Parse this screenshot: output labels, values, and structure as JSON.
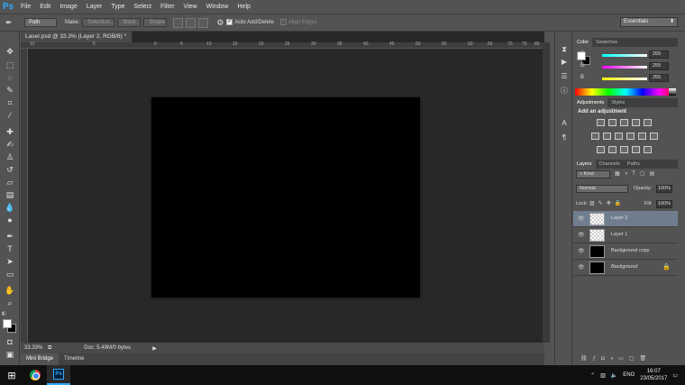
{
  "app": {
    "logo": "Ps"
  },
  "menubar": {
    "items": [
      "File",
      "Edit",
      "Image",
      "Layer",
      "Type",
      "Select",
      "Filter",
      "View",
      "Window",
      "Help"
    ]
  },
  "options_bar": {
    "mode_value": "Path",
    "make_label": "Make:",
    "selection_label": "Selection...",
    "mask_label": "Mask",
    "shape_label": "Shape",
    "auto_add_delete_label": "Auto Add/Delete",
    "align_edges_label": "Align Edges",
    "workspace_value": "Essentials"
  },
  "document": {
    "tab_title": "Laser.psd @ 33.3% (Layer 2, RGB/8) *",
    "close_icon": "×",
    "ruler_h_labels": [
      "10",
      "5",
      "0",
      "5",
      "10",
      "15",
      "20",
      "25",
      "30",
      "35",
      "40",
      "45",
      "50",
      "55",
      "60",
      "65",
      "70",
      "75",
      "80"
    ],
    "zoom": "33.33%",
    "doc_info": "Doc: 5.49M/0 bytes",
    "bottom_tabs": [
      "Mini Bridge",
      "Timeline"
    ]
  },
  "color_panel": {
    "tabs": [
      "Color",
      "Swatches"
    ],
    "channels": [
      {
        "label": "R",
        "value": "255"
      },
      {
        "label": "G",
        "value": "255"
      },
      {
        "label": "B",
        "value": "255"
      }
    ]
  },
  "adjustments_panel": {
    "tabs": [
      "Adjustments",
      "Styles"
    ],
    "heading": "Add an adjustment"
  },
  "layers_panel": {
    "tabs": [
      "Layers",
      "Channels",
      "Paths"
    ],
    "filter_value": "Kind",
    "blend_mode": "Normal",
    "opacity_label": "Opacity:",
    "opacity_value": "100%",
    "lock_label": "Lock:",
    "fill_label": "Fill:",
    "fill_value": "100%",
    "layers": [
      {
        "name": "Layer 2",
        "thumb": "transparent",
        "selected": true
      },
      {
        "name": "Layer 1",
        "thumb": "transparent",
        "selected": false
      },
      {
        "name": "Background copy",
        "thumb": "black",
        "selected": false
      },
      {
        "name": "Background",
        "thumb": "black",
        "selected": false,
        "locked": true
      }
    ]
  },
  "taskbar": {
    "language": "ENG",
    "time": "16:07",
    "date": "23/05/2017"
  },
  "colors": {
    "ui_bg": "#535353",
    "canvas": "#000000",
    "pasteboard": "#282828",
    "selected_layer": "#6f7d8f",
    "accent": "#31a8ff"
  }
}
